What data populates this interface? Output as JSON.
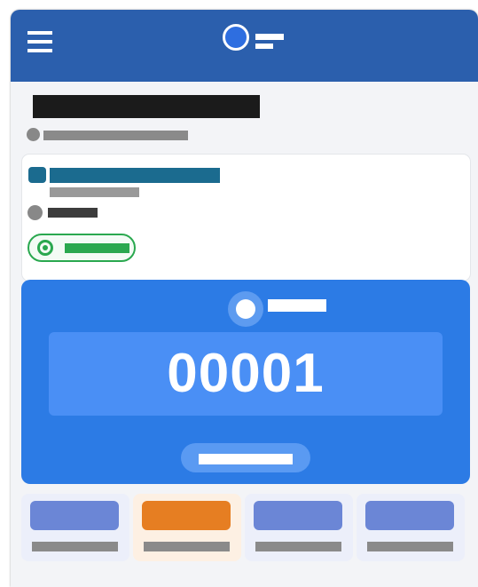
{
  "app": {
    "header": {
      "menu_icon": "hamburger-menu-icon",
      "logo_icon": "app-logo-icon"
    }
  },
  "colors": {
    "header": "#2b5fad",
    "ticket": "#2c7be5",
    "status_green": "#2aa84f",
    "active_tab": "#e67e22",
    "tab_icon": "#6b86d6"
  },
  "ticket": {
    "number": "00001",
    "icon": "ticket-icon"
  },
  "nav": {
    "active_index": 1,
    "items": [
      {
        "icon": "nav-tab-1-icon"
      },
      {
        "icon": "nav-tab-2-icon"
      },
      {
        "icon": "nav-tab-3-icon"
      },
      {
        "icon": "nav-tab-4-icon"
      }
    ]
  }
}
